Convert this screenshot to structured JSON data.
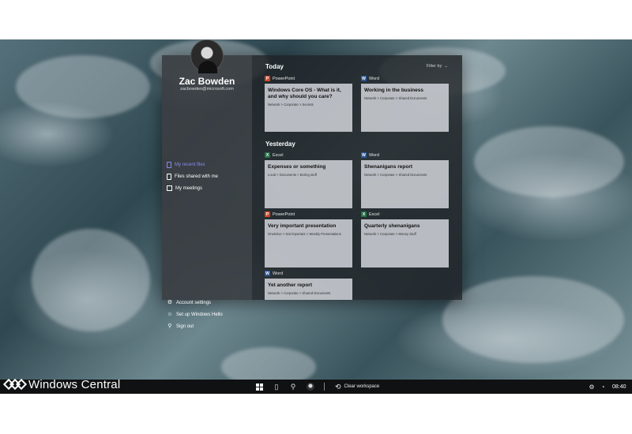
{
  "user": {
    "name": "Zac Bowden",
    "email": "zacbowden@microsoft.com"
  },
  "sidebar": {
    "nav": [
      {
        "label": "My recent files",
        "icon": "document-icon",
        "active": true
      },
      {
        "label": "Files shared with me",
        "icon": "shared-files-icon",
        "active": false
      },
      {
        "label": "My meetings",
        "icon": "calendar-icon",
        "active": false
      }
    ],
    "bottom": [
      {
        "label": "Account settings",
        "icon": "gear-icon"
      },
      {
        "label": "Set up Windows Hello",
        "icon": "windows-hello-icon"
      },
      {
        "label": "Sign out",
        "icon": "person-icon"
      }
    ]
  },
  "main": {
    "filter_label": "Filter by",
    "sections": [
      {
        "title": "Today",
        "files": [
          {
            "app": "PowerPoint",
            "app_color": "#d24726",
            "title": "Windows Core OS - What is it, and why should you care?",
            "path": "Network > Corporate > Secrets"
          },
          {
            "app": "Word",
            "app_color": "#2b579a",
            "title": "Working in the business",
            "path": "Network > Corporate > Shared Documents"
          }
        ]
      },
      {
        "title": "Yesterday",
        "files": [
          {
            "app": "Excel",
            "app_color": "#217346",
            "title": "Expenses or something",
            "path": "Local > Documents > Boring stuff"
          },
          {
            "app": "Word",
            "app_color": "#2b579a",
            "title": "Shenanigans report",
            "path": "Network > Corporate > Shared Documents"
          },
          {
            "app": "PowerPoint",
            "app_color": "#d24726",
            "title": "Very important presentation",
            "path": "OneDrive > Not important > Weekly Presentations"
          },
          {
            "app": "Excel",
            "app_color": "#217346",
            "title": "Quarterly shenanigans",
            "path": "Network > Corporate > Money Stuff"
          },
          {
            "app": "Word",
            "app_color": "#2b579a",
            "title": "Yet another report",
            "path": "Network > Corporate > Shared Documents"
          }
        ]
      }
    ]
  },
  "taskbar": {
    "brand": "Windows Central",
    "clear_workspace": "Clear workspace",
    "time": "08:40"
  },
  "colors": {
    "accent_active": "#8b8cf0"
  }
}
